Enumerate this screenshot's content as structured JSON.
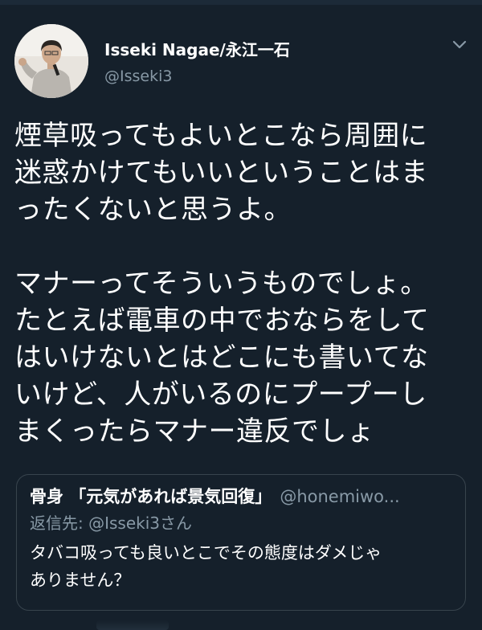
{
  "tweet": {
    "author_name": "Isseki Nagae/永江一石",
    "author_handle": "@Isseki3",
    "text_lines": [
      "煙草吸ってもよいとこなら周囲に",
      "迷惑かけてもいいということはま",
      "ったくないと思うよ。",
      "",
      "マナーってそういうものでしょ。",
      "たとえば電車の中でおならをして",
      "はいけないとはどこにも書いてな",
      "いけど、人がいるのにプープーし",
      "まくったらマナー違反でしょ"
    ]
  },
  "quoted": {
    "author_name": "骨身 「元気があれば景気回復」",
    "author_handle": "@honemiwo...",
    "reply_to": "返信先: @Isseki3さん",
    "text_lines": [
      "タバコ吸っても良いとこでその態度はダメじゃ",
      "ありません？"
    ]
  },
  "icons": {
    "menu": "chevron-down-icon",
    "avatar": "user-avatar-photo"
  },
  "colors": {
    "background": "#15202b",
    "secondary_text": "#8899a6",
    "border": "#38444d"
  }
}
